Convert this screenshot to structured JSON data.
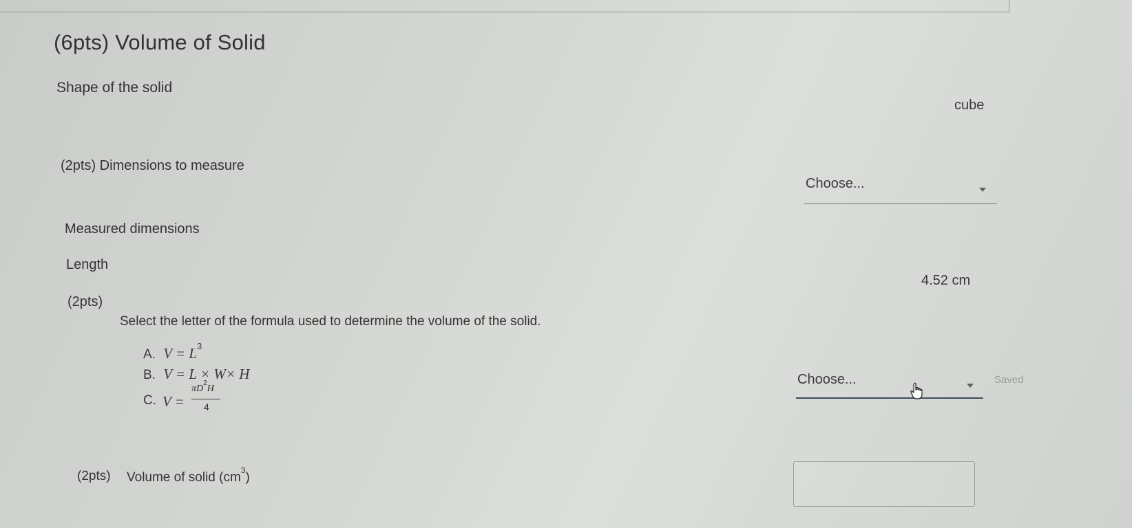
{
  "question": {
    "title": "(6pts) Volume of Solid",
    "shape_label": "Shape of the solid",
    "shape_value": "cube",
    "dimensions": {
      "label": "(2pts)  Dimensions to measure",
      "select_value": "Choose..."
    },
    "measured_label": "Measured dimensions",
    "length": {
      "label": "Length",
      "value": "4.52 cm"
    },
    "formula_question": {
      "points": "(2pts)",
      "prompt": "Select the letter of the formula used to determine the volume of the solid.",
      "options": [
        {
          "letter": "A.",
          "formula": "V = L",
          "exp": "3"
        },
        {
          "letter": "B.",
          "formula": "V = L × W× H"
        },
        {
          "letter": "C.",
          "lhs": "V =",
          "numerator": "πD",
          "num_exp": "2",
          "num_tail": "H",
          "denominator": "4"
        }
      ],
      "select_value": "Choose...",
      "status": "Saved"
    },
    "volume": {
      "points": "(2pts)",
      "label": "Volume of solid (cm",
      "unit_exp": "3",
      "label_close": ")",
      "input_value": ""
    }
  },
  "icons": {
    "caret": "caret-down-icon",
    "cursor": "hand-pointer-icon"
  },
  "colors": {
    "background": "#d4d6d3",
    "text": "#333333",
    "active_underline": "#3d4b5a",
    "saved_text": "#9a9c9a"
  }
}
